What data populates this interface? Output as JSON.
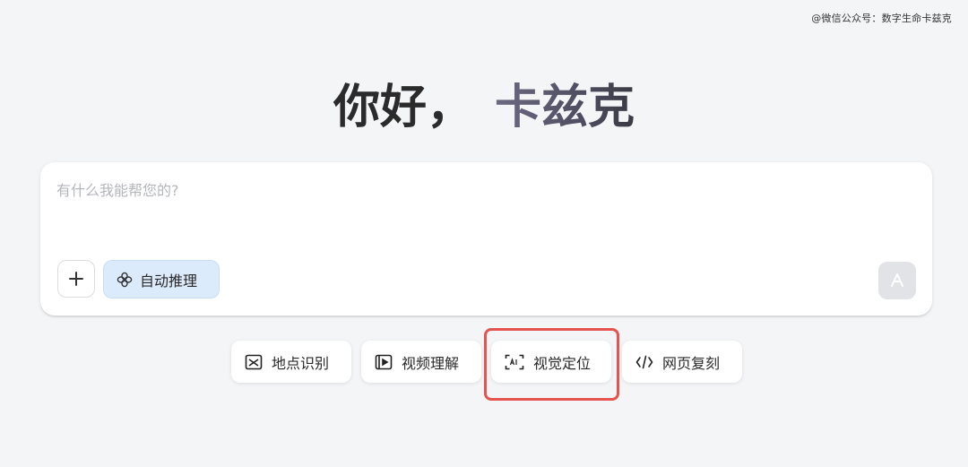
{
  "watermark": "@微信公众号：数字生命卡兹克",
  "greeting": {
    "hello": "你好，",
    "name": "卡兹克"
  },
  "composer": {
    "placeholder": "有什么我能帮您的?",
    "value": "",
    "auto_reasoning_label": "自动推理",
    "icons": {
      "plus": "plus-icon",
      "auto_reasoning": "flower-icon",
      "send": "send-arrow-icon"
    }
  },
  "quick_actions": [
    {
      "label": "地点识别",
      "icon": "image-locate-icon"
    },
    {
      "label": "视频理解",
      "icon": "video-icon"
    },
    {
      "label": "视觉定位",
      "icon": "scan-ai-icon",
      "highlighted": true
    },
    {
      "label": "网页复刻",
      "icon": "code-icon"
    }
  ],
  "colors": {
    "background": "#f4f5f7",
    "highlight": "#e5544f",
    "auto_reasoning_bg": "#dcebfb",
    "send_disabled_bg": "#e2e3e6"
  }
}
